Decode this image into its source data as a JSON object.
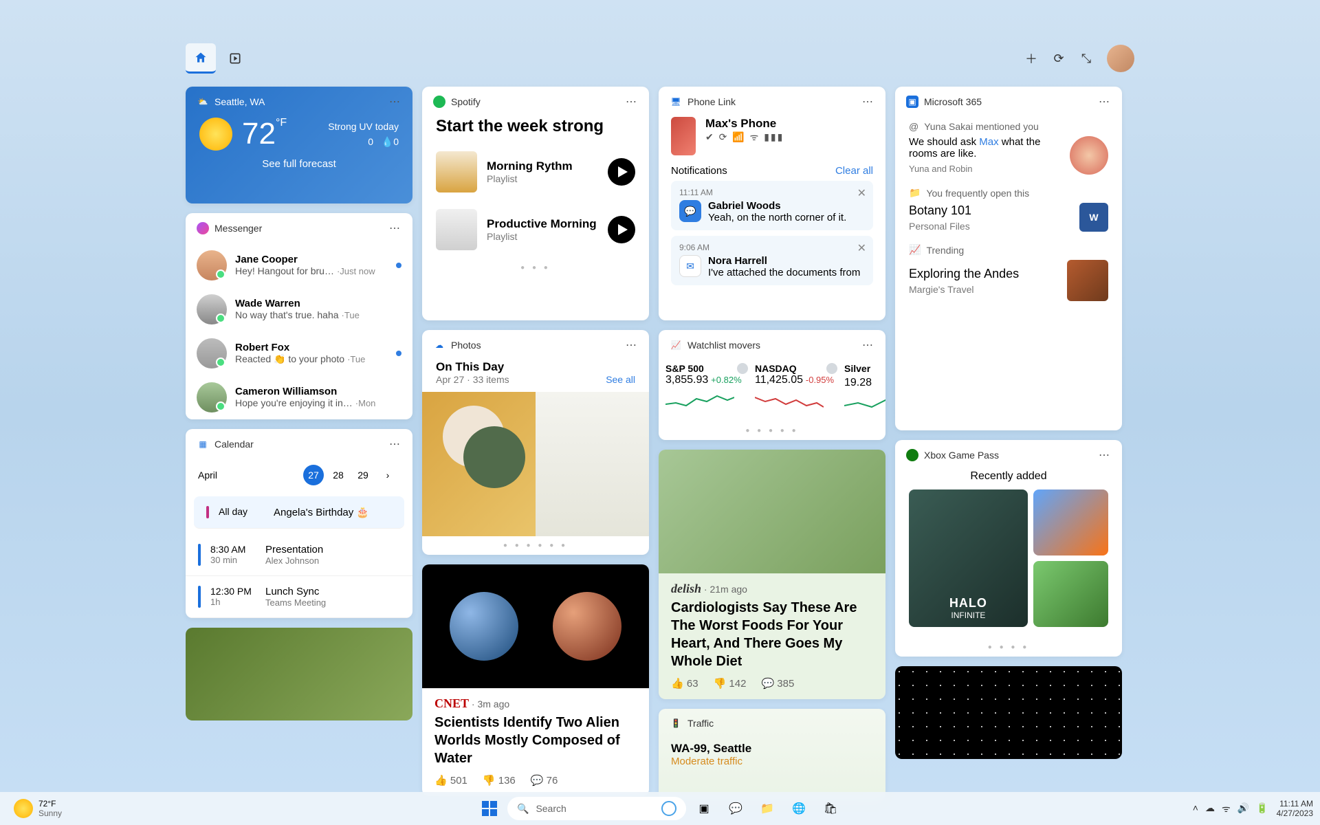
{
  "topbar": {
    "home": "home",
    "play": "play"
  },
  "weather": {
    "location": "Seattle, WA",
    "temp": "72",
    "unit": "°F",
    "uv": "Strong UV today",
    "uv_index": "0",
    "humidity": "0",
    "forecast_link": "See full forecast"
  },
  "messenger": {
    "title": "Messenger",
    "items": [
      {
        "name": "Jane Cooper",
        "text": "Hey! Hangout for bru…",
        "time": "·Just now",
        "unread": true
      },
      {
        "name": "Wade Warren",
        "text": "No way that's true. haha",
        "time": "·Tue",
        "unread": false
      },
      {
        "name": "Robert Fox",
        "text": "Reacted 👏 to your photo",
        "time": "·Tue",
        "unread": true
      },
      {
        "name": "Cameron Williamson",
        "text": "Hope you're enjoying it in…",
        "time": "·Mon",
        "unread": false
      }
    ]
  },
  "calendar": {
    "title": "Calendar",
    "month": "April",
    "dates": [
      "27",
      "28",
      "29"
    ],
    "events": [
      {
        "time": "All day",
        "dur": "",
        "title": "Angela's Birthday 🎂",
        "sub": "",
        "color": "#c22f82"
      },
      {
        "time": "8:30 AM",
        "dur": "30 min",
        "title": "Presentation",
        "sub": "Alex Johnson",
        "color": "#1a6fdc"
      },
      {
        "time": "12:30 PM",
        "dur": "1h",
        "title": "Lunch Sync",
        "sub": "Teams Meeting",
        "color": "#1a6fdc"
      }
    ]
  },
  "spotify": {
    "title": "Spotify",
    "heading": "Start the week strong",
    "items": [
      {
        "title": "Morning Rythm",
        "sub": "Playlist"
      },
      {
        "title": "Productive Morning",
        "sub": "Playlist"
      }
    ]
  },
  "photos": {
    "title": "Photos",
    "heading": "On This Day",
    "date": "Apr 27",
    "count": "33 items",
    "seeall": "See all"
  },
  "news_cnet": {
    "source": "CNET",
    "time": "· 3m ago",
    "headline": "Scientists Identify Two Alien Worlds Mostly Composed of Water",
    "likes": "501",
    "dislikes": "136",
    "comments": "76"
  },
  "phonelink": {
    "title": "Phone Link",
    "device": "Max's Phone",
    "notif_header": "Notifications",
    "clear": "Clear all",
    "notifs": [
      {
        "time": "11:11 AM",
        "name": "Gabriel Woods",
        "text": "Yeah, on the north corner of it.",
        "app": "msg"
      },
      {
        "time": "9:06 AM",
        "name": "Nora Harrell",
        "text": "I've attached the documents from",
        "app": "mail"
      }
    ]
  },
  "watchlist": {
    "title": "Watchlist movers",
    "items": [
      {
        "name": "S&P 500",
        "value": "3,855.93",
        "change": "+0.82%",
        "dir": "up"
      },
      {
        "name": "NASDAQ",
        "value": "11,425.05",
        "change": "-0.95%",
        "dir": "down"
      },
      {
        "name": "Silver",
        "value": "19.28",
        "change": "",
        "dir": "up"
      }
    ]
  },
  "news_food": {
    "source": "delish",
    "time": "· 21m ago",
    "headline": "Cardiologists Say These Are The Worst Foods For Your Heart, And There Goes My Whole Diet",
    "likes": "63",
    "dislikes": "142",
    "comments": "385"
  },
  "traffic": {
    "title": "Traffic",
    "route": "WA-99, Seattle",
    "status": "Moderate traffic"
  },
  "m365": {
    "title": "Microsoft 365",
    "mention_label": "Yuna Sakai mentioned you",
    "mention_text_a": "We should ask ",
    "mention_name": "Max",
    "mention_text_b": " what the rooms are like.",
    "people": "Yuna and Robin",
    "freq_label": "You frequently open this",
    "doc_title": "Botany 101",
    "doc_sub": "Personal Files",
    "trend_label": "Trending",
    "trend_title": "Exploring the Andes",
    "trend_sub": "Margie's Travel"
  },
  "xbox": {
    "title": "Xbox Game Pass",
    "sub": "Recently added",
    "game1": "HALO",
    "game1b": "INFINITE"
  },
  "taskbar": {
    "temp": "72°F",
    "cond": "Sunny",
    "search": "Search",
    "time": "11:11 AM",
    "date": "4/27/2023"
  }
}
